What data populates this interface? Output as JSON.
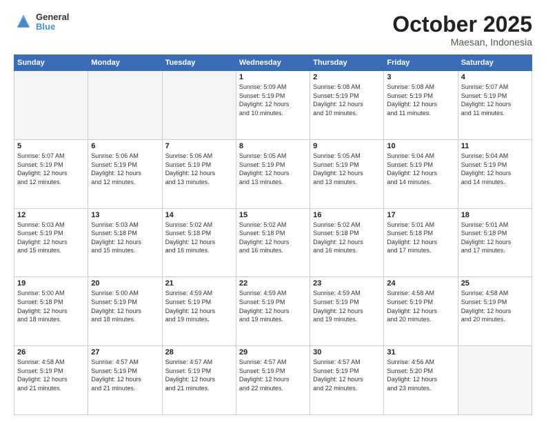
{
  "header": {
    "logo": {
      "line1": "General",
      "line2": "Blue"
    },
    "title": "October 2025",
    "location": "Maesan, Indonesia"
  },
  "weekdays": [
    "Sunday",
    "Monday",
    "Tuesday",
    "Wednesday",
    "Thursday",
    "Friday",
    "Saturday"
  ],
  "weeks": [
    [
      {
        "day": "",
        "info": ""
      },
      {
        "day": "",
        "info": ""
      },
      {
        "day": "",
        "info": ""
      },
      {
        "day": "1",
        "info": "Sunrise: 5:09 AM\nSunset: 5:19 PM\nDaylight: 12 hours\nand 10 minutes."
      },
      {
        "day": "2",
        "info": "Sunrise: 5:08 AM\nSunset: 5:19 PM\nDaylight: 12 hours\nand 10 minutes."
      },
      {
        "day": "3",
        "info": "Sunrise: 5:08 AM\nSunset: 5:19 PM\nDaylight: 12 hours\nand 11 minutes."
      },
      {
        "day": "4",
        "info": "Sunrise: 5:07 AM\nSunset: 5:19 PM\nDaylight: 12 hours\nand 11 minutes."
      }
    ],
    [
      {
        "day": "5",
        "info": "Sunrise: 5:07 AM\nSunset: 5:19 PM\nDaylight: 12 hours\nand 12 minutes."
      },
      {
        "day": "6",
        "info": "Sunrise: 5:06 AM\nSunset: 5:19 PM\nDaylight: 12 hours\nand 12 minutes."
      },
      {
        "day": "7",
        "info": "Sunrise: 5:06 AM\nSunset: 5:19 PM\nDaylight: 12 hours\nand 13 minutes."
      },
      {
        "day": "8",
        "info": "Sunrise: 5:05 AM\nSunset: 5:19 PM\nDaylight: 12 hours\nand 13 minutes."
      },
      {
        "day": "9",
        "info": "Sunrise: 5:05 AM\nSunset: 5:19 PM\nDaylight: 12 hours\nand 13 minutes."
      },
      {
        "day": "10",
        "info": "Sunrise: 5:04 AM\nSunset: 5:19 PM\nDaylight: 12 hours\nand 14 minutes."
      },
      {
        "day": "11",
        "info": "Sunrise: 5:04 AM\nSunset: 5:19 PM\nDaylight: 12 hours\nand 14 minutes."
      }
    ],
    [
      {
        "day": "12",
        "info": "Sunrise: 5:03 AM\nSunset: 5:19 PM\nDaylight: 12 hours\nand 15 minutes."
      },
      {
        "day": "13",
        "info": "Sunrise: 5:03 AM\nSunset: 5:18 PM\nDaylight: 12 hours\nand 15 minutes."
      },
      {
        "day": "14",
        "info": "Sunrise: 5:02 AM\nSunset: 5:18 PM\nDaylight: 12 hours\nand 16 minutes."
      },
      {
        "day": "15",
        "info": "Sunrise: 5:02 AM\nSunset: 5:18 PM\nDaylight: 12 hours\nand 16 minutes."
      },
      {
        "day": "16",
        "info": "Sunrise: 5:02 AM\nSunset: 5:18 PM\nDaylight: 12 hours\nand 16 minutes."
      },
      {
        "day": "17",
        "info": "Sunrise: 5:01 AM\nSunset: 5:18 PM\nDaylight: 12 hours\nand 17 minutes."
      },
      {
        "day": "18",
        "info": "Sunrise: 5:01 AM\nSunset: 5:18 PM\nDaylight: 12 hours\nand 17 minutes."
      }
    ],
    [
      {
        "day": "19",
        "info": "Sunrise: 5:00 AM\nSunset: 5:18 PM\nDaylight: 12 hours\nand 18 minutes."
      },
      {
        "day": "20",
        "info": "Sunrise: 5:00 AM\nSunset: 5:19 PM\nDaylight: 12 hours\nand 18 minutes."
      },
      {
        "day": "21",
        "info": "Sunrise: 4:59 AM\nSunset: 5:19 PM\nDaylight: 12 hours\nand 19 minutes."
      },
      {
        "day": "22",
        "info": "Sunrise: 4:59 AM\nSunset: 5:19 PM\nDaylight: 12 hours\nand 19 minutes."
      },
      {
        "day": "23",
        "info": "Sunrise: 4:59 AM\nSunset: 5:19 PM\nDaylight: 12 hours\nand 19 minutes."
      },
      {
        "day": "24",
        "info": "Sunrise: 4:58 AM\nSunset: 5:19 PM\nDaylight: 12 hours\nand 20 minutes."
      },
      {
        "day": "25",
        "info": "Sunrise: 4:58 AM\nSunset: 5:19 PM\nDaylight: 12 hours\nand 20 minutes."
      }
    ],
    [
      {
        "day": "26",
        "info": "Sunrise: 4:58 AM\nSunset: 5:19 PM\nDaylight: 12 hours\nand 21 minutes."
      },
      {
        "day": "27",
        "info": "Sunrise: 4:57 AM\nSunset: 5:19 PM\nDaylight: 12 hours\nand 21 minutes."
      },
      {
        "day": "28",
        "info": "Sunrise: 4:57 AM\nSunset: 5:19 PM\nDaylight: 12 hours\nand 21 minutes."
      },
      {
        "day": "29",
        "info": "Sunrise: 4:57 AM\nSunset: 5:19 PM\nDaylight: 12 hours\nand 22 minutes."
      },
      {
        "day": "30",
        "info": "Sunrise: 4:57 AM\nSunset: 5:19 PM\nDaylight: 12 hours\nand 22 minutes."
      },
      {
        "day": "31",
        "info": "Sunrise: 4:56 AM\nSunset: 5:20 PM\nDaylight: 12 hours\nand 23 minutes."
      },
      {
        "day": "",
        "info": ""
      }
    ]
  ]
}
